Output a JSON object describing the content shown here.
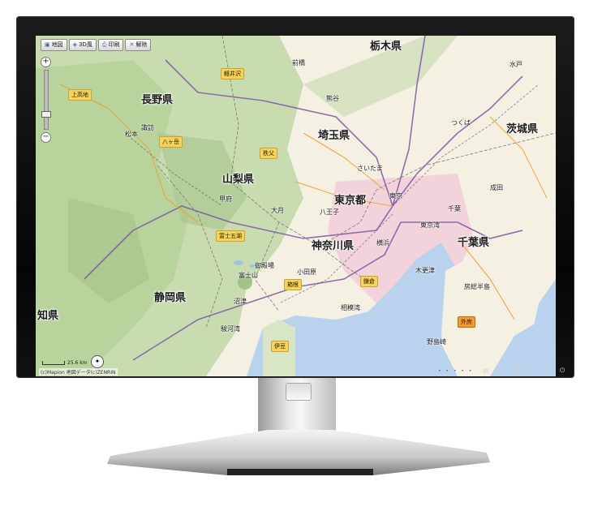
{
  "toolbar": {
    "map_label": "地図",
    "view3d_label": "3D風",
    "print_label": "印刷",
    "clear_label": "解除"
  },
  "prefectures": {
    "tochigi": "栃木県",
    "nagano": "長野県",
    "saitama": "埼玉県",
    "ibaraki": "茨城県",
    "yamanashi": "山梨県",
    "tokyo": "東京都",
    "kanagawa": "神奈川県",
    "chiba": "千葉県",
    "shizuoka": "静岡県",
    "aichi_partial": "知県"
  },
  "tags": {
    "kamikochi": "上高地",
    "karuizawa": "軽井沢",
    "yatsugatake": "八ヶ岳",
    "chichibu": "秩父",
    "fujigoko": "富士五湖",
    "hakone": "箱根",
    "kamakura": "鎌倉",
    "izu": "伊豆",
    "sotobo": "外房"
  },
  "cities": {
    "takasaki": "前橋",
    "mito": "水戸",
    "tsukuba": "つくば",
    "saitama": "さいたま",
    "tokyo": "東京",
    "chiba": "千葉",
    "yokohama": "横浜",
    "kofu": "甲府",
    "fujisan": "富士山",
    "otsuki": "大月",
    "hachioji": "八王子",
    "tokyo_bay": "東京湾",
    "boso": "房総半島",
    "sagami_bay": "相模湾",
    "suruga_bay": "駿河湾",
    "nojimazaki": "野島崎",
    "matsumoto": "松本",
    "suwa": "諏訪",
    "gotemba": "御殿場",
    "odawara": "小田原",
    "numazu": "沼津",
    "kisarazu": "木更津",
    "narita": "成田",
    "kumagaya": "熊谷"
  },
  "footer": {
    "scale": "25.6 km",
    "copyright": "(c)Mapion 地図データ(c)ZENRIN"
  },
  "colors": {
    "sea": "#b9d3ee",
    "land_low": "#f4f1e2",
    "land_forest": "#c9dcb0",
    "mountain": "#a9c78f",
    "urban": "#f2c8d8",
    "highway": "#7e57a8",
    "national_road": "#f0a030",
    "railway": "#555555"
  },
  "bezel_icons": [
    "input-icon",
    "menu-icon",
    "panel-icon",
    "minus-icon",
    "plus-icon",
    "power-icon"
  ]
}
